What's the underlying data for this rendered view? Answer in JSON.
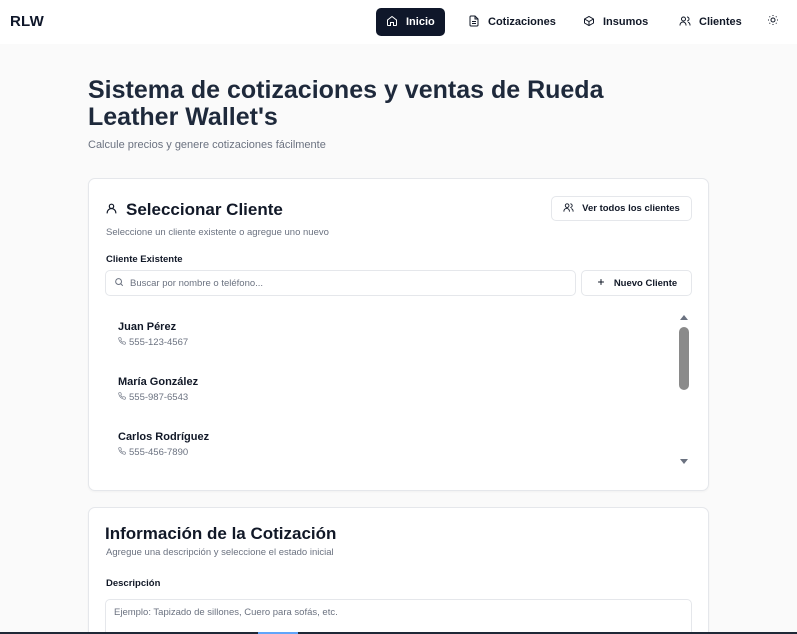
{
  "brand": "RLW",
  "nav": {
    "items": [
      {
        "label": "Inicio",
        "icon": "home-icon",
        "active": true
      },
      {
        "label": "Cotizaciones",
        "icon": "document-icon",
        "active": false
      },
      {
        "label": "Insumos",
        "icon": "box-icon",
        "active": false
      },
      {
        "label": "Clientes",
        "icon": "users-icon",
        "active": false
      }
    ],
    "theme_icon": "sun-icon"
  },
  "page": {
    "title": "Sistema de cotizaciones y ventas de Rueda Leather Wallet's",
    "subtitle": "Calcule precios y genere cotizaciones fácilmente"
  },
  "client_card": {
    "title": "Seleccionar Cliente",
    "description": "Seleccione un cliente existente o agregue uno nuevo",
    "view_all_label": "Ver todos los clientes",
    "field_label": "Cliente Existente",
    "search_placeholder": "Buscar por nombre o teléfono...",
    "new_client_label": "Nuevo Cliente",
    "clients": [
      {
        "name": "Juan Pérez",
        "phone": "555-123-4567"
      },
      {
        "name": "María González",
        "phone": "555-987-6543"
      },
      {
        "name": "Carlos Rodríguez",
        "phone": "555-456-7890"
      }
    ]
  },
  "quote_card": {
    "title": "Información de la Cotización",
    "description": "Agregue una descripción y seleccione el estado inicial",
    "field_label": "Descripción",
    "description_placeholder": "Ejemplo: Tapizado de sillones, Cuero para sofás, etc."
  },
  "colors": {
    "primary": "#0f172a",
    "muted_text": "#6b7280",
    "border": "#e5e7eb"
  }
}
